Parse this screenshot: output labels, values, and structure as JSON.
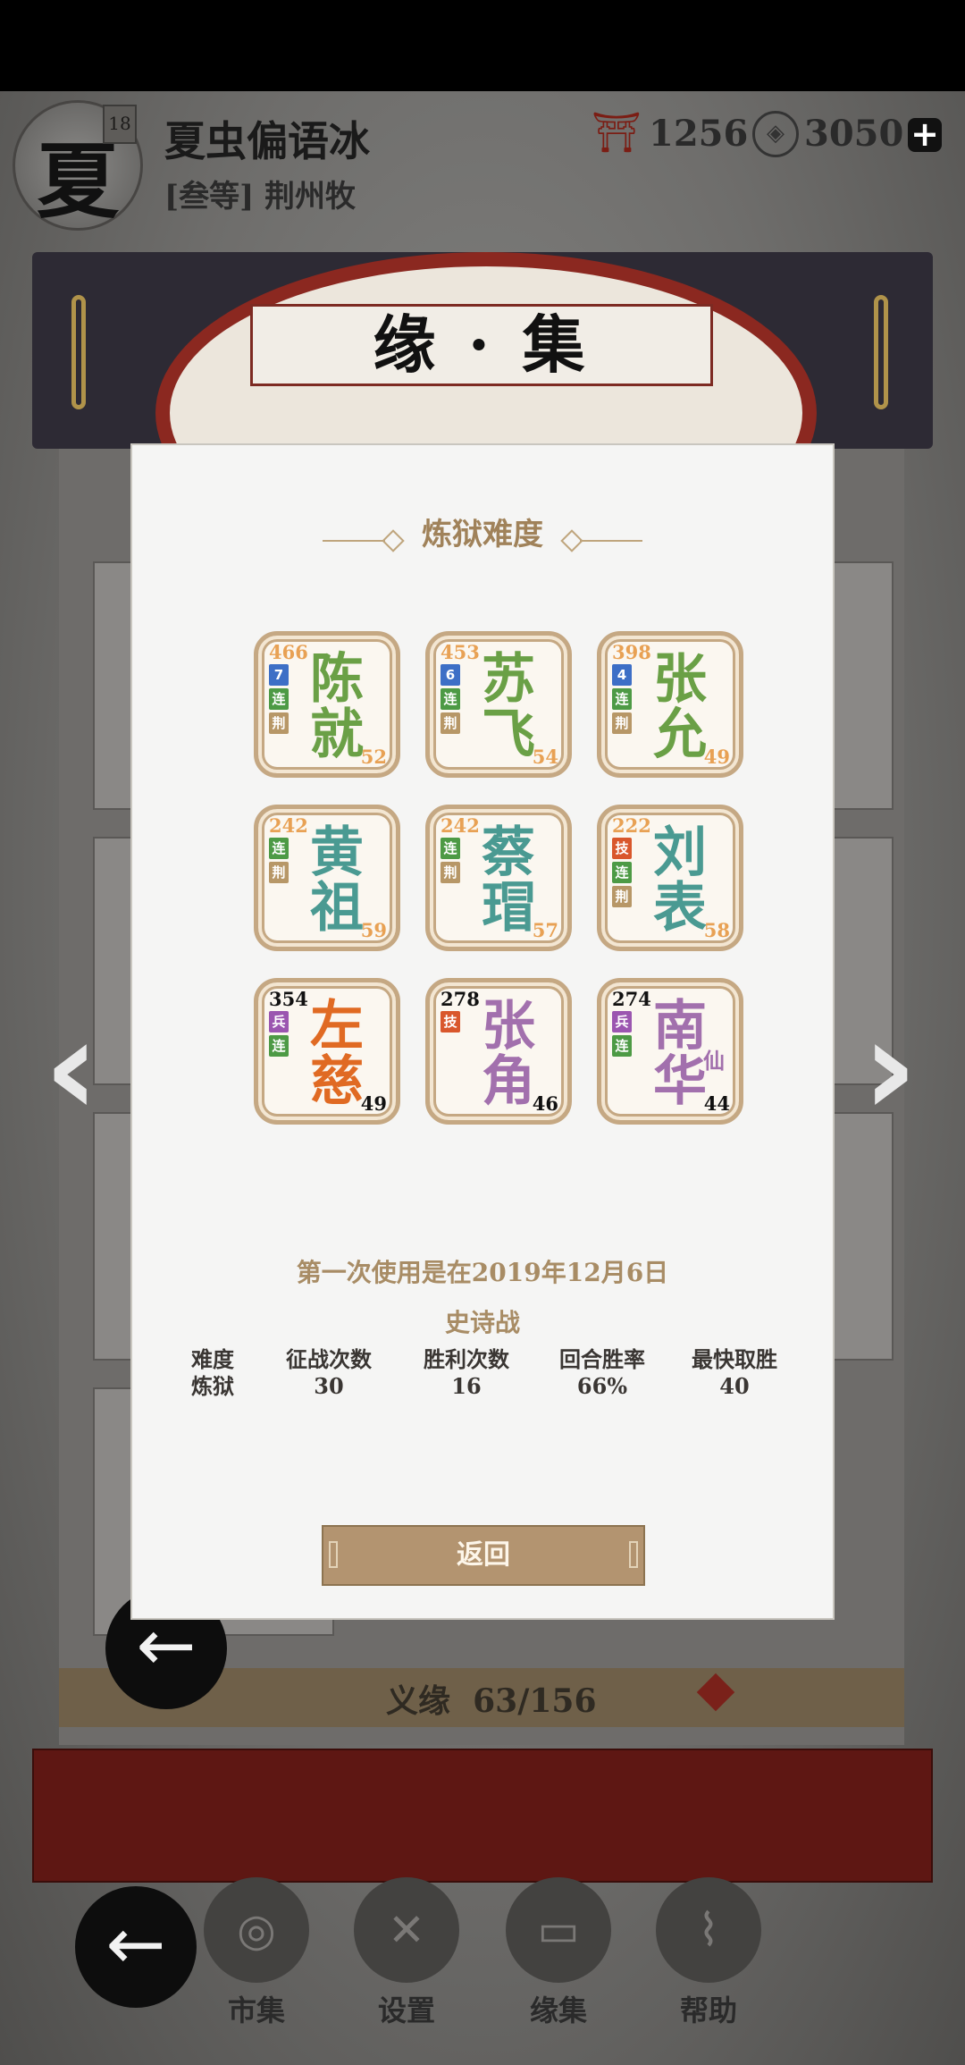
{
  "player": {
    "avatar_char": "夏",
    "level": "18",
    "name": "夏虫偏语冰",
    "rank": "[叁等] 荆州牧",
    "currency1": "1256",
    "currency2": "3050",
    "currency1_icon": "red-gate-icon",
    "currency2_icon": "coin-icon"
  },
  "scroll": {
    "title": "缘 · 集",
    "progress_label": "义缘",
    "progress_value": "63/156"
  },
  "modal": {
    "title": "炼狱难度",
    "cards": [
      {
        "name": "陈就",
        "num": "466",
        "lv": "52",
        "color": "#6aa046",
        "tags": [
          {
            "t": "7",
            "c": "#3d6fc6"
          },
          {
            "t": "连",
            "c": "#4d9a45"
          },
          {
            "t": "荆",
            "c": "#b79767"
          }
        ]
      },
      {
        "name": "苏飞",
        "num": "453",
        "lv": "54",
        "color": "#6aa046",
        "tags": [
          {
            "t": "6",
            "c": "#3d6fc6"
          },
          {
            "t": "连",
            "c": "#4d9a45"
          },
          {
            "t": "荆",
            "c": "#b79767"
          }
        ]
      },
      {
        "name": "张允",
        "num": "398",
        "lv": "49",
        "color": "#6aa046",
        "tags": [
          {
            "t": "4",
            "c": "#3d6fc6"
          },
          {
            "t": "连",
            "c": "#4d9a45"
          },
          {
            "t": "荆",
            "c": "#b79767"
          }
        ]
      },
      {
        "name": "黄祖",
        "num": "242",
        "lv": "59",
        "color": "#4a9a92",
        "tags": [
          {
            "t": "连",
            "c": "#4d9a45"
          },
          {
            "t": "荆",
            "c": "#b79767"
          }
        ]
      },
      {
        "name": "蔡瑁",
        "num": "242",
        "lv": "57",
        "color": "#4a9a92",
        "tags": [
          {
            "t": "连",
            "c": "#4d9a45"
          },
          {
            "t": "荆",
            "c": "#b79767"
          }
        ]
      },
      {
        "name": "刘表",
        "num": "222",
        "lv": "58",
        "color": "#4a9a92",
        "tags": [
          {
            "t": "技",
            "c": "#d9572c"
          },
          {
            "t": "连",
            "c": "#4d9a45"
          },
          {
            "t": "荆",
            "c": "#b79767"
          }
        ]
      },
      {
        "name": "左慈",
        "num": "354",
        "lv": "49",
        "color": "#e06a23",
        "dark": true,
        "tags": [
          {
            "t": "兵",
            "c": "#9b56b0"
          },
          {
            "t": "连",
            "c": "#4d9a45"
          }
        ]
      },
      {
        "name": "张角",
        "num": "278",
        "lv": "46",
        "color": "#a270ad",
        "dark": true,
        "tags": [
          {
            "t": "技",
            "c": "#d9572c"
          }
        ]
      },
      {
        "name": "南华",
        "num": "274",
        "lv": "44",
        "color": "#a270ad",
        "dark": true,
        "sub": "仙",
        "tags": [
          {
            "t": "兵",
            "c": "#9b56b0"
          },
          {
            "t": "连",
            "c": "#4d9a45"
          }
        ]
      }
    ],
    "first_use": "第一次使用是在2019年12月6日",
    "battle_type": "史诗战",
    "stats": [
      {
        "h": "难度",
        "v": "炼狱"
      },
      {
        "h": "征战次数",
        "v": "30"
      },
      {
        "h": "胜利次数",
        "v": "16"
      },
      {
        "h": "回合胜率",
        "v": "66%"
      },
      {
        "h": "最快取胜",
        "v": "40"
      }
    ],
    "return_label": "返回"
  },
  "menu": [
    {
      "label": "市集",
      "icon": "market-icon"
    },
    {
      "label": "设置",
      "icon": "settings-icon"
    },
    {
      "label": "缘集",
      "icon": "collection-book-icon"
    },
    {
      "label": "帮助",
      "icon": "help-scroll-icon"
    }
  ]
}
